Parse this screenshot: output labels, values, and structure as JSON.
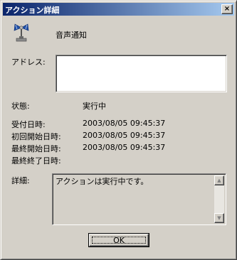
{
  "window": {
    "title": "アクション詳細",
    "close_glyph": "×"
  },
  "header": {
    "icon": "speaker-icon",
    "name": "音声通知"
  },
  "address": {
    "label": "アドレス:",
    "value": ""
  },
  "status": {
    "label": "状態:",
    "value": "実行中"
  },
  "times": {
    "received_label": "受付日時:",
    "received_value": "2003/08/05 09:45:37",
    "first_start_label": "初回開始日時:",
    "first_start_value": "2003/08/05 09:45:37",
    "last_start_label": "最終開始日時:",
    "last_start_value": "2003/08/05 09:45:37",
    "last_end_label": "最終終了日時:",
    "last_end_value": ""
  },
  "details": {
    "label": "詳細:",
    "text": "アクションは実行中です。"
  },
  "buttons": {
    "ok_label": "OK"
  }
}
